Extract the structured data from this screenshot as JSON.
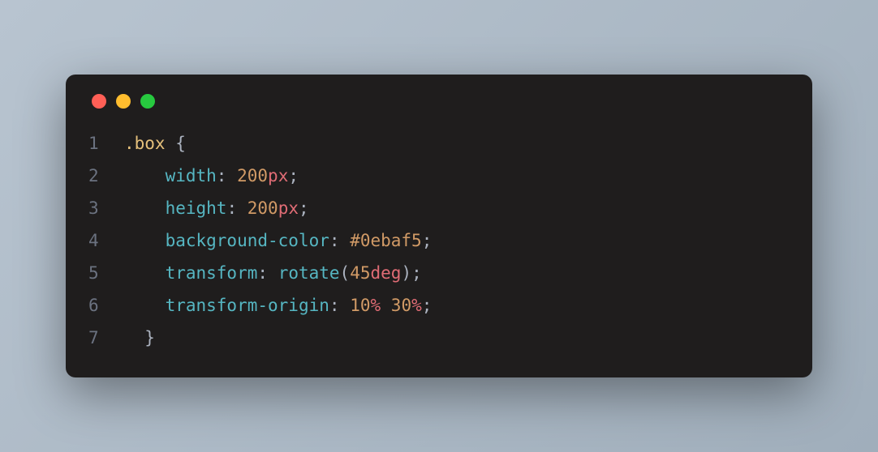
{
  "titlebar": {
    "buttons": [
      "close",
      "minimize",
      "maximize"
    ]
  },
  "code": {
    "language": "css",
    "lines": [
      {
        "num": "1",
        "indent": "",
        "tokens": [
          {
            "t": ".box",
            "c": "tok-sel"
          },
          {
            "t": " ",
            "c": "tok-default"
          },
          {
            "t": "{",
            "c": "tok-punc"
          }
        ]
      },
      {
        "num": "2",
        "indent": "    ",
        "tokens": [
          {
            "t": "width",
            "c": "tok-prop"
          },
          {
            "t": ":",
            "c": "tok-punc"
          },
          {
            "t": " ",
            "c": "tok-default"
          },
          {
            "t": "200",
            "c": "tok-num"
          },
          {
            "t": "px",
            "c": "tok-unit"
          },
          {
            "t": ";",
            "c": "tok-punc"
          }
        ]
      },
      {
        "num": "3",
        "indent": "    ",
        "tokens": [
          {
            "t": "height",
            "c": "tok-prop"
          },
          {
            "t": ":",
            "c": "tok-punc"
          },
          {
            "t": " ",
            "c": "tok-default"
          },
          {
            "t": "200",
            "c": "tok-num"
          },
          {
            "t": "px",
            "c": "tok-unit"
          },
          {
            "t": ";",
            "c": "tok-punc"
          }
        ]
      },
      {
        "num": "4",
        "indent": "    ",
        "tokens": [
          {
            "t": "background-color",
            "c": "tok-prop"
          },
          {
            "t": ":",
            "c": "tok-punc"
          },
          {
            "t": " ",
            "c": "tok-default"
          },
          {
            "t": "#0ebaf5",
            "c": "tok-hex"
          },
          {
            "t": ";",
            "c": "tok-punc"
          }
        ]
      },
      {
        "num": "5",
        "indent": "    ",
        "tokens": [
          {
            "t": "transform",
            "c": "tok-prop"
          },
          {
            "t": ":",
            "c": "tok-punc"
          },
          {
            "t": " ",
            "c": "tok-default"
          },
          {
            "t": "rotate",
            "c": "tok-func"
          },
          {
            "t": "(",
            "c": "tok-punc"
          },
          {
            "t": "45",
            "c": "tok-num"
          },
          {
            "t": "deg",
            "c": "tok-unit"
          },
          {
            "t": ")",
            "c": "tok-punc"
          },
          {
            "t": ";",
            "c": "tok-punc"
          }
        ]
      },
      {
        "num": "6",
        "indent": "    ",
        "tokens": [
          {
            "t": "transform-origin",
            "c": "tok-prop"
          },
          {
            "t": ":",
            "c": "tok-punc"
          },
          {
            "t": " ",
            "c": "tok-default"
          },
          {
            "t": "10",
            "c": "tok-num"
          },
          {
            "t": "%",
            "c": "tok-unit"
          },
          {
            "t": " ",
            "c": "tok-default"
          },
          {
            "t": "30",
            "c": "tok-num"
          },
          {
            "t": "%",
            "c": "tok-unit"
          },
          {
            "t": ";",
            "c": "tok-punc"
          }
        ]
      },
      {
        "num": "7",
        "indent": "  ",
        "tokens": [
          {
            "t": "}",
            "c": "tok-punc"
          }
        ]
      }
    ]
  }
}
